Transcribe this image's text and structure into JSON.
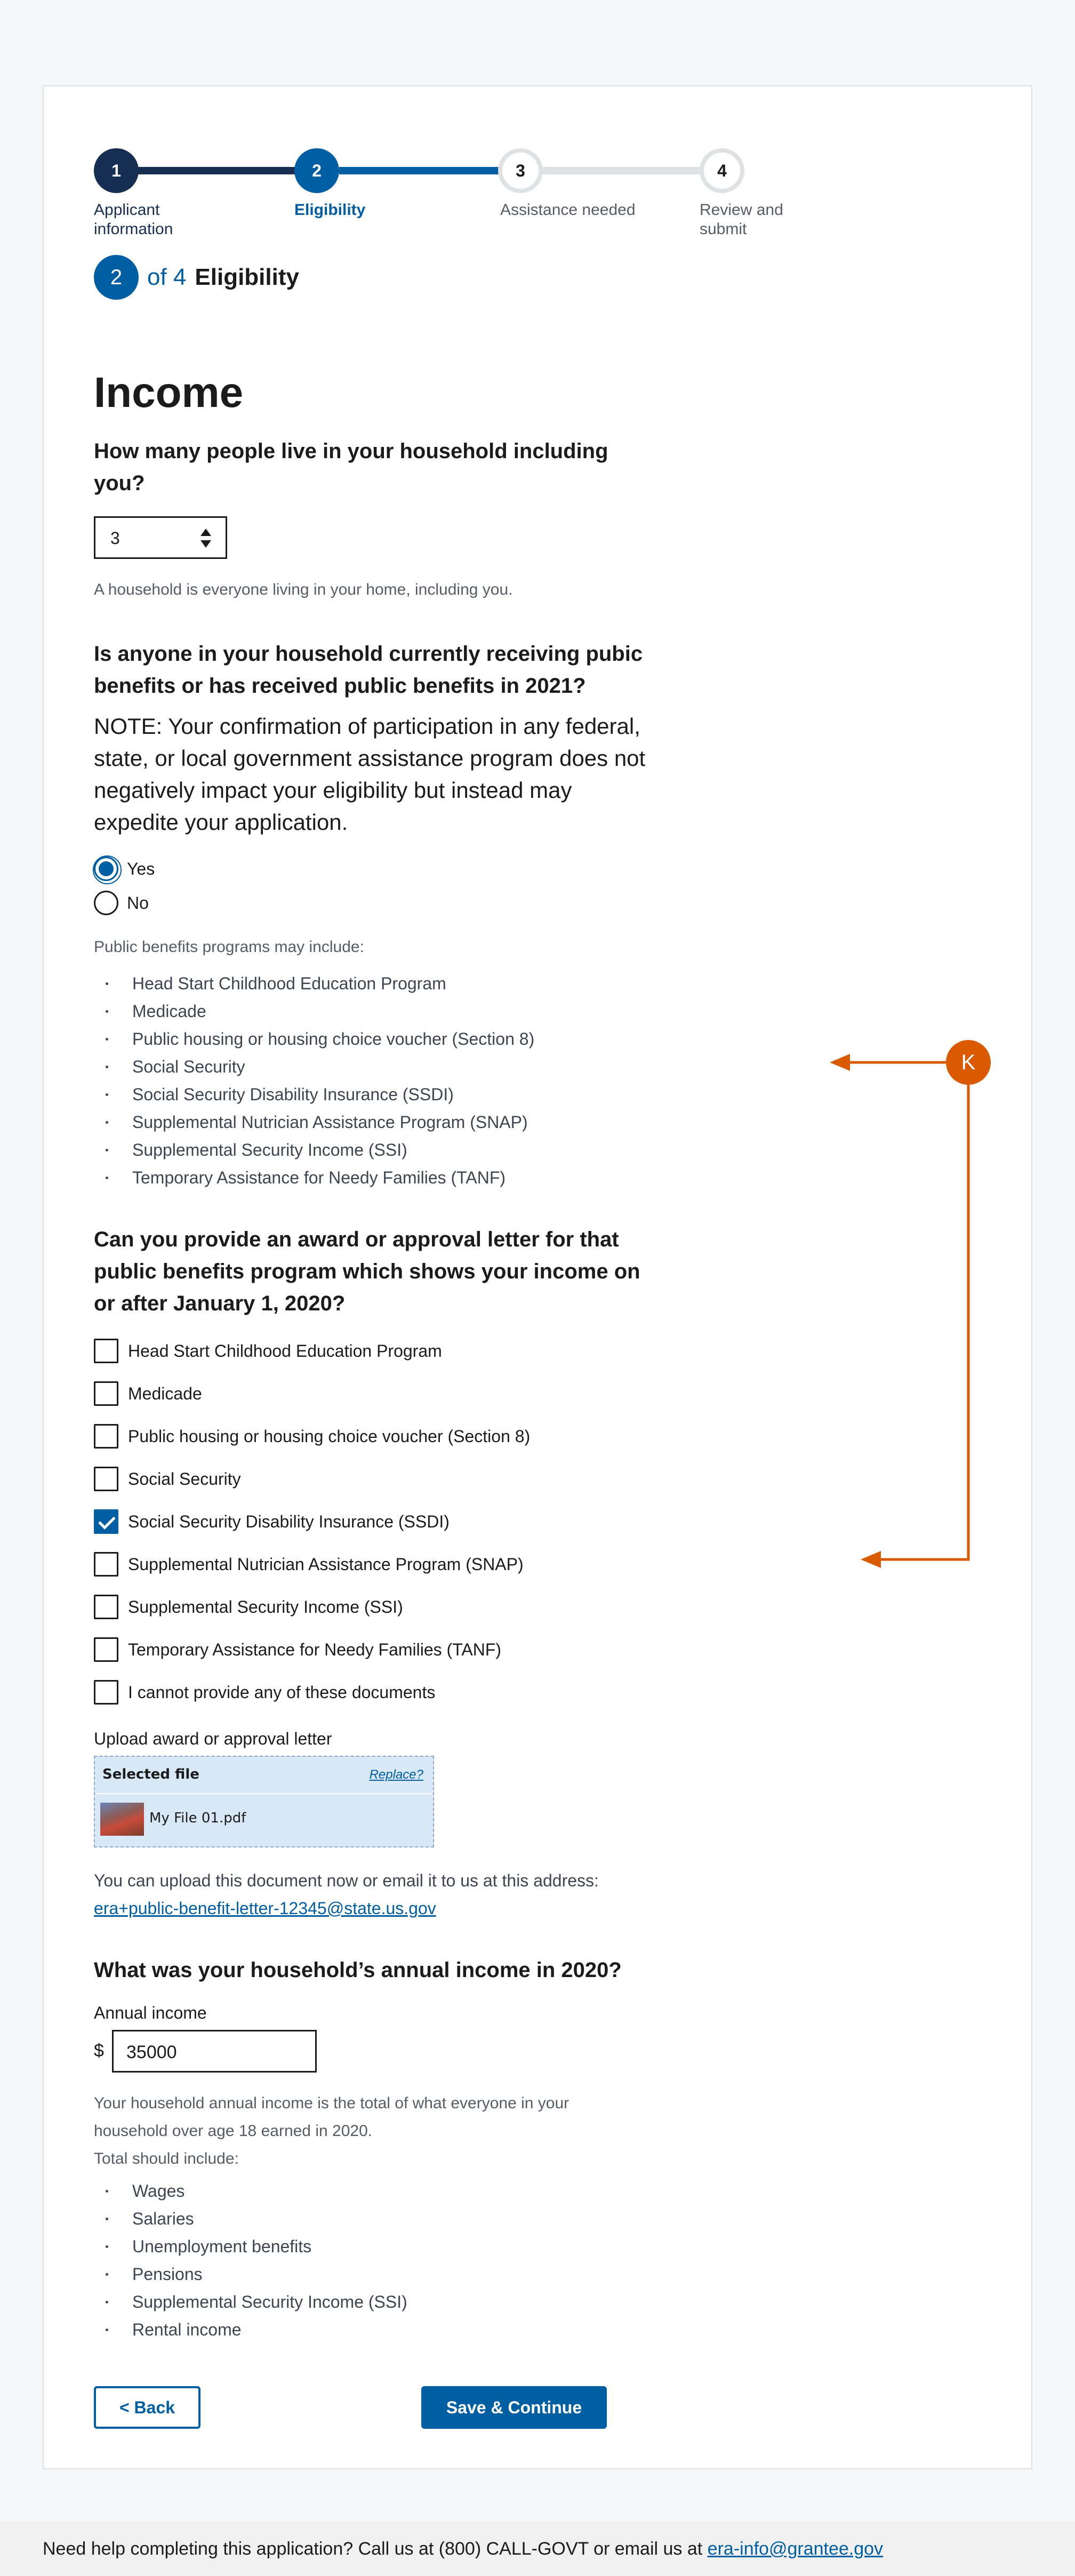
{
  "steps": [
    {
      "num": "1",
      "label": "Applicant information",
      "state": "done"
    },
    {
      "num": "2",
      "label": "Eligibility",
      "state": "current"
    },
    {
      "num": "3",
      "label": "Assistance needed",
      "state": "todo"
    },
    {
      "num": "4",
      "label": "Review and submit",
      "state": "todo"
    }
  ],
  "counter": {
    "current": "2",
    "of": "of 4",
    "heading": "Eligibility"
  },
  "page_title": "Income",
  "household": {
    "question": "How many people live in your household including you?",
    "value": "3",
    "hint": "A household is everyone living in your home, including you."
  },
  "benefits": {
    "question": "Is anyone in your household currently receiving pubic benefits or has received public benefits in 2021?",
    "note": "NOTE: Your confirmation of participation in any federal, state, or local government assistance program does not negatively impact your eligibility but instead may expedite your application.",
    "options": [
      "Yes",
      "No"
    ],
    "selected": "Yes",
    "list_intro": "Public benefits programs may include:",
    "programs": [
      "Head Start Childhood Education Program",
      "Medicade",
      "Public housing or housing choice voucher (Section 8)",
      "Social Security",
      "Social Security Disability Insurance (SSDI)",
      "Supplemental Nutrician Assistance Program (SNAP)",
      "Supplemental Security Income (SSI)",
      "Temporary Assistance for Needy Families (TANF)"
    ]
  },
  "letter": {
    "question": "Can you provide an award or approval letter for that public benefits program which shows your income on or after January 1, 2020?",
    "checkboxes": [
      {
        "label": "Head Start Childhood Education Program",
        "checked": false
      },
      {
        "label": "Medicade",
        "checked": false
      },
      {
        "label": "Public housing or housing choice voucher (Section 8)",
        "checked": false
      },
      {
        "label": "Social Security",
        "checked": false
      },
      {
        "label": "Social Security Disability Insurance (SSDI)",
        "checked": true
      },
      {
        "label": "Supplemental Nutrician Assistance Program (SNAP)",
        "checked": false
      },
      {
        "label": "Supplemental Security Income (SSI)",
        "checked": false
      },
      {
        "label": "Temporary Assistance for Needy Families (TANF)",
        "checked": false
      },
      {
        "label": "I cannot provide any of these documents",
        "checked": false
      }
    ],
    "upload_label": "Upload award or approval letter",
    "selected_file_label": "Selected file",
    "replace_label": "Replace?",
    "file_name": "My File 01.pdf",
    "upload_hint": "You can upload this document now or email it to us at this address:",
    "upload_email": "era+public-benefit-letter-12345@state.us.gov"
  },
  "income": {
    "question": "What was your household’s annual income in 2020?",
    "label": "Annual income",
    "currency": "$",
    "value": "35000",
    "hint_line1": "Your household annual income is the total of what everyone in your household over age 18 earned in 2020.",
    "hint_line2": "Total should include:",
    "items": [
      "Wages",
      "Salaries",
      "Unemployment benefits",
      "Pensions",
      "Supplemental Security Income (SSI)",
      "Rental income"
    ]
  },
  "buttons": {
    "back": "< Back",
    "save": "Save & Continue"
  },
  "footer": {
    "text": "Need help completing this application? Call us at (800) CALL-GOVT or email us at",
    "email": "era-info@grantee.gov"
  },
  "annotation": {
    "badge": "K",
    "color": "#d95a00"
  }
}
